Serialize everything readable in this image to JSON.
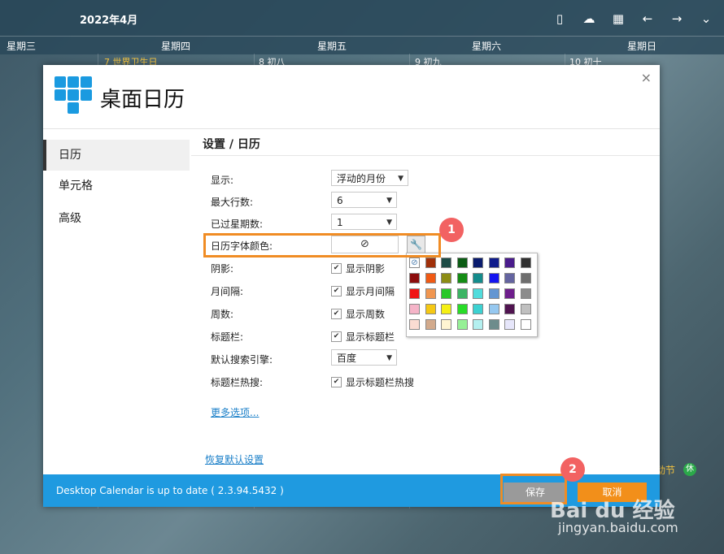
{
  "topbar": {
    "month": "2022年4月"
  },
  "weekdays": [
    "星期三",
    "星期四",
    "星期五",
    "星期六",
    "星期日"
  ],
  "days": [
    {
      "num": "7",
      "label": "世界卫生日"
    },
    {
      "num": "8",
      "label": "初八"
    },
    {
      "num": "9",
      "label": "初九"
    },
    {
      "num": "10",
      "label": "初十"
    }
  ],
  "bg_holiday": "动节",
  "bg_badge": "休",
  "dialog": {
    "title": "桌面日历",
    "close": "×",
    "sidebar": [
      {
        "label": "日历"
      },
      {
        "label": "单元格"
      },
      {
        "label": "高级"
      }
    ],
    "breadcrumb": "设置 / 日历",
    "rows": {
      "display_label": "显示:",
      "display_value": "浮动的月份",
      "maxrows_label": "最大行数:",
      "maxrows_value": "6",
      "pastweeks_label": "已过星期数:",
      "pastweeks_value": "1",
      "fontcolor_label": "日历字体颜色:",
      "fontcolor_value": "⃠",
      "shadow_label": "阴影:",
      "shadow_chk": "显示阴影",
      "monthgap_label": "月间隔:",
      "monthgap_chk": "显示月间隔",
      "weeknum_label": "周数:",
      "weeknum_chk": "显示周数",
      "titlebar_label": "标题栏:",
      "titlebar_chk": "显示标题栏",
      "search_label": "默认搜索引擎:",
      "search_value": "百度",
      "hot_label": "标题栏热搜:",
      "hot_chk": "显示标题栏热搜"
    },
    "more_link": "更多选项...",
    "restore_link": "恢复默认设置",
    "footer_text": "Desktop Calendar is up to date ( 2.3.94.5432 )",
    "save": "保存",
    "cancel": "取消"
  },
  "palette_colors": [
    [
      "none",
      "#a0300a",
      "#1e4c46",
      "#0c5c14",
      "#0a1c6e",
      "#101c8c",
      "#4a1c8c",
      "#303030"
    ],
    [
      "#8c0c0c",
      "#f05a14",
      "#8c8c14",
      "#148c14",
      "#148c8c",
      "#1414f0",
      "#6464a0",
      "#6e6e6e"
    ],
    [
      "#f01414",
      "#f09650",
      "#28c828",
      "#3cb464",
      "#50dcdc",
      "#6496d2",
      "#6e1e8c",
      "#8c8c8c"
    ],
    [
      "#f5b4c8",
      "#f5c814",
      "#f5f014",
      "#28dc28",
      "#3cd2d2",
      "#96c8f0",
      "#501450",
      "#c0c0c0"
    ],
    [
      "#fadcd2",
      "#d2aa8c",
      "#fff5d2",
      "#96f096",
      "#b4f0f0",
      "#6e8c8c",
      "#e6e6fa",
      "#ffffff"
    ]
  ],
  "badges": [
    "1",
    "2"
  ],
  "watermark": {
    "brand": "Bai du 经验",
    "url": "jingyan.baidu.com"
  }
}
